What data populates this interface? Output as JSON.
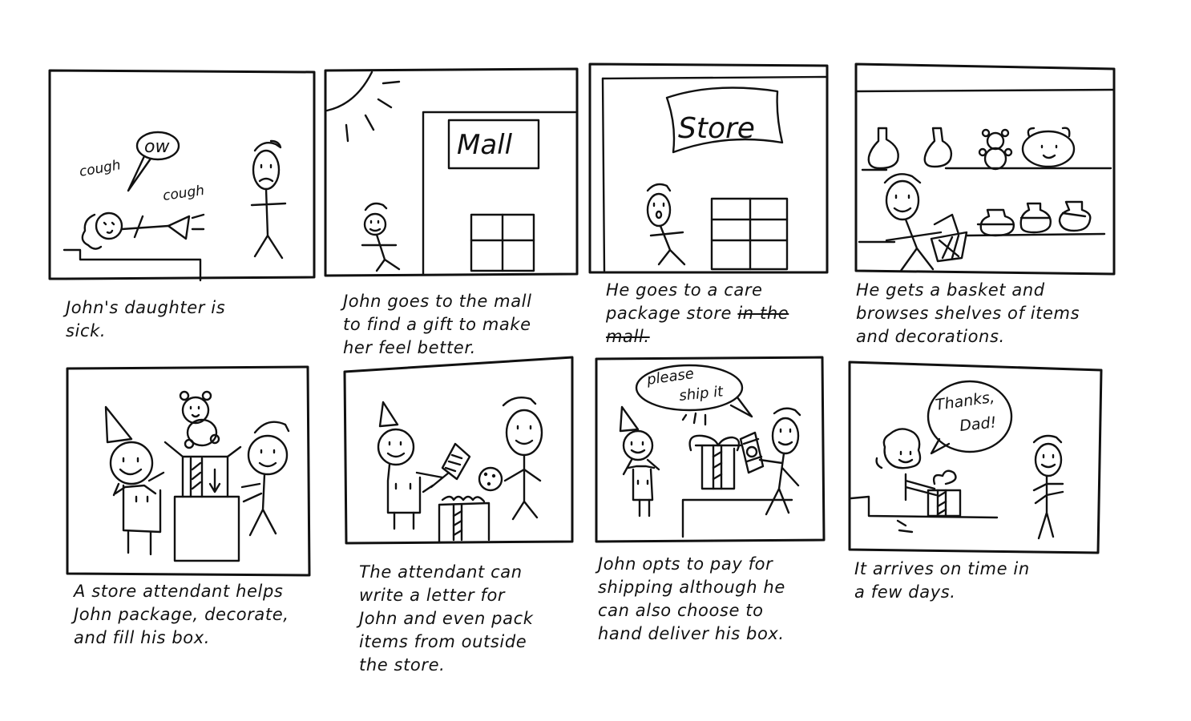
{
  "panels": [
    {
      "id": 1,
      "bubbles": {
        "ow": "ow",
        "cough1": "cough",
        "cough2": "cough"
      },
      "caption": [
        "John's daughter is",
        "sick."
      ]
    },
    {
      "id": 2,
      "sign": "Mall",
      "caption": [
        "John goes to the mall",
        "to find a gift to make",
        "her feel better."
      ]
    },
    {
      "id": 3,
      "sign": "Store",
      "caption_line1": "He goes to a care",
      "caption_line2_a": "package store ",
      "caption_line2_struck": "in the",
      "caption_line3_struck": "mall."
    },
    {
      "id": 4,
      "caption": [
        "He gets a basket and",
        "browses shelves of items",
        "and decorations."
      ]
    },
    {
      "id": 5,
      "caption": [
        "A store attendant helps",
        "John package, decorate,",
        "and fill his box."
      ]
    },
    {
      "id": 6,
      "caption": [
        "The attendant can",
        "write a letter for",
        "John and even pack",
        "items from outside",
        "the store."
      ]
    },
    {
      "id": 7,
      "bubble_line1": "please",
      "bubble_line2": "ship it",
      "caption": [
        "John opts to pay for",
        "shipping although he",
        "can also choose to",
        "hand deliver his box."
      ]
    },
    {
      "id": 8,
      "bubble_line1": "Thanks,",
      "bubble_line2": "Dad!",
      "caption": [
        "It arrives on time in",
        "a few days."
      ]
    }
  ]
}
